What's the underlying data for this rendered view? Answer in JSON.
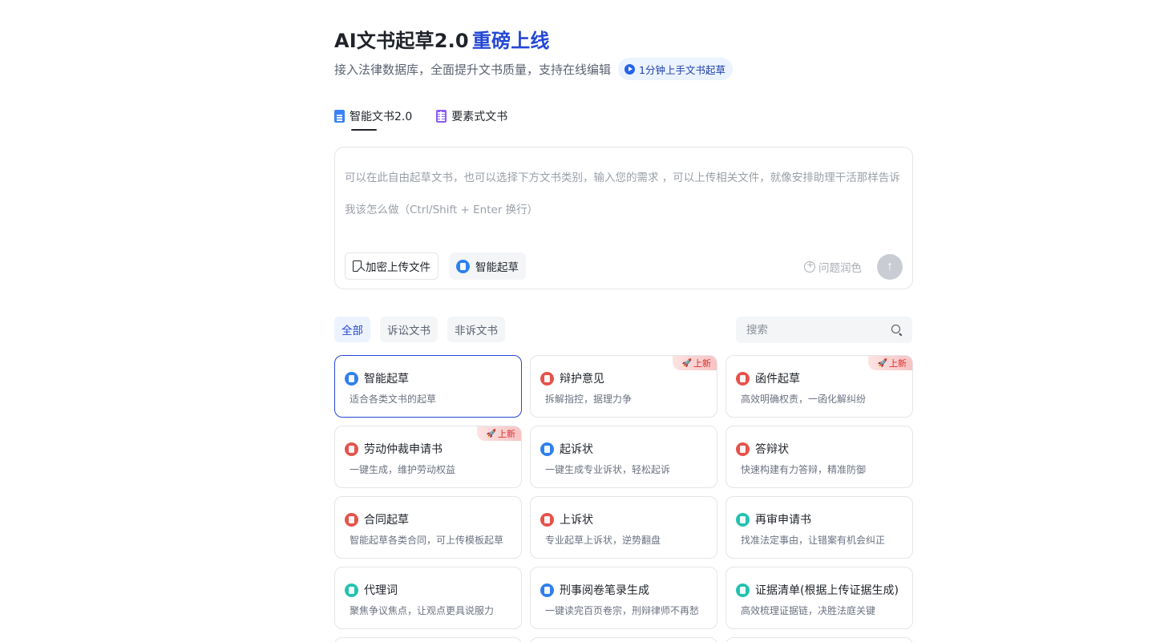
{
  "hero": {
    "title": "AI文书起草2.0",
    "title_accent": "重磅上线",
    "subtitle": "接入法律数据库，全面提升文书质量，支持在线编辑",
    "guide_label": "1分钟上手文书起草"
  },
  "mode_tabs": [
    {
      "label": "智能文书2.0",
      "icon": "document-icon",
      "active": true
    },
    {
      "label": "要素式文书",
      "icon": "form-grid-icon",
      "active": false
    }
  ],
  "composer": {
    "placeholder": "可以在此自由起草文书，也可以选择下方文书类别，输入您的需求 ，可以上传相关文件，就像安排助理干活那样告诉我该怎么做（Ctrl/Shift + Enter 换行）",
    "upload_label": "加密上传文件",
    "smart_label": "智能起草",
    "polish_label": "问题润色",
    "send_icon": "arrow-up-icon"
  },
  "filters": [
    {
      "label": "全部",
      "active": true
    },
    {
      "label": "诉讼文书",
      "active": false
    },
    {
      "label": "非诉文书",
      "active": false
    }
  ],
  "search": {
    "placeholder": "搜索"
  },
  "new_badge": "上新",
  "cards": [
    {
      "title": "智能起草",
      "desc": "适合各类文书的起草",
      "icon_color": "#2f80ed",
      "new": false,
      "selected": true
    },
    {
      "title": "辩护意见",
      "desc": "拆解指控，据理力争",
      "icon_color": "#e5534b",
      "new": true,
      "selected": false
    },
    {
      "title": "函件起草",
      "desc": "高效明确权责，一函化解纠纷",
      "icon_color": "#e5534b",
      "new": true,
      "selected": false
    },
    {
      "title": "劳动仲裁申请书",
      "desc": "一键生成，维护劳动权益",
      "icon_color": "#e5534b",
      "new": true,
      "selected": false
    },
    {
      "title": "起诉状",
      "desc": "一键生成专业诉状，轻松起诉",
      "icon_color": "#2f80ed",
      "new": false,
      "selected": false
    },
    {
      "title": "答辩状",
      "desc": "快速构建有力答辩，精准防御",
      "icon_color": "#e5534b",
      "new": false,
      "selected": false
    },
    {
      "title": "合同起草",
      "desc": "智能起草各类合同，可上传模板起草",
      "icon_color": "#e5534b",
      "new": false,
      "selected": false
    },
    {
      "title": "上诉状",
      "desc": "专业起草上诉状，逆势翻盘",
      "icon_color": "#e5534b",
      "new": false,
      "selected": false
    },
    {
      "title": "再审申请书",
      "desc": "找准法定事由，让错案有机会纠正",
      "icon_color": "#23c2b0",
      "new": false,
      "selected": false
    },
    {
      "title": "代理词",
      "desc": "聚焦争议焦点，让观点更具说服力",
      "icon_color": "#23c2b0",
      "new": false,
      "selected": false
    },
    {
      "title": "刑事阅卷笔录生成",
      "desc": "一键读完百页卷宗，刑辩律师不再愁",
      "icon_color": "#2f80ed",
      "new": false,
      "selected": false
    },
    {
      "title": "证据清单(根据上传证据生成)",
      "desc": "高效梳理证据链，决胜法庭关键",
      "icon_color": "#23c2b0",
      "new": false,
      "selected": false
    }
  ]
}
